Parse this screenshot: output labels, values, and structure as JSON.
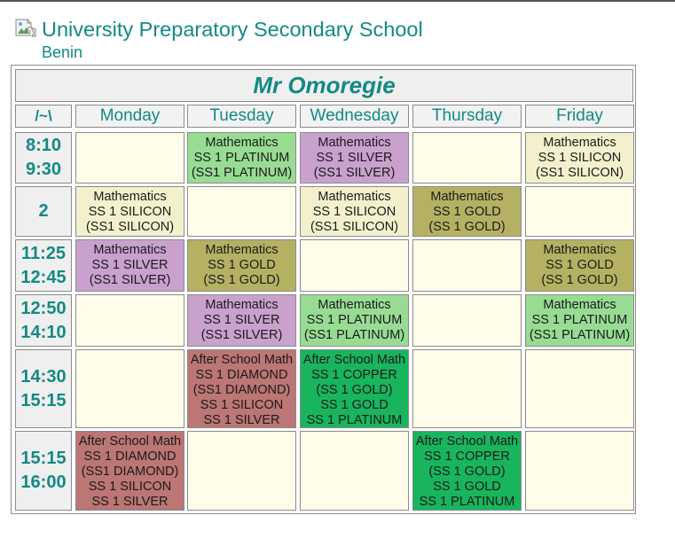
{
  "school": {
    "name": "University Preparatory Secondary School",
    "location": "Benin"
  },
  "timetable": {
    "teacher": "Mr Omoregie",
    "corner_label": "/~\\",
    "days": [
      "Monday",
      "Tuesday",
      "Wednesday",
      "Thursday",
      "Friday"
    ],
    "periods": [
      {
        "time": [
          "8:10",
          "9:30"
        ],
        "slots": [
          null,
          {
            "lines": [
              "Mathematics",
              "SS 1 PLATINUM",
              "(SS1 PLATINUM)"
            ],
            "color": "#98dc94"
          },
          {
            "lines": [
              "Mathematics",
              "SS 1 SILVER",
              "(SS1 SILVER)"
            ],
            "color": "#c8a2cd"
          },
          null,
          {
            "lines": [
              "Mathematics",
              "SS 1 SILICON",
              "(SS1 SILICON)"
            ],
            "color": "#f3f1cd"
          }
        ]
      },
      {
        "time": [
          "2"
        ],
        "slots": [
          {
            "lines": [
              "Mathematics",
              "SS 1 SILICON",
              "(SS1 SILICON)"
            ],
            "color": "#f3f1cd"
          },
          null,
          {
            "lines": [
              "Mathematics",
              "SS 1 SILICON",
              "(SS1 SILICON)"
            ],
            "color": "#f3f1cd"
          },
          {
            "lines": [
              "Mathematics",
              "SS 1 GOLD",
              "(SS 1 GOLD)"
            ],
            "color": "#b5b163"
          },
          null
        ]
      },
      {
        "time": [
          "11:25",
          "12:45"
        ],
        "slots": [
          {
            "lines": [
              "Mathematics",
              "SS 1 SILVER",
              "(SS1 SILVER)"
            ],
            "color": "#c8a2cd"
          },
          {
            "lines": [
              "Mathematics",
              "SS 1 GOLD",
              "(SS 1 GOLD)"
            ],
            "color": "#b5b163"
          },
          null,
          null,
          {
            "lines": [
              "Mathematics",
              "SS 1 GOLD",
              "(SS 1 GOLD)"
            ],
            "color": "#b5b163"
          }
        ]
      },
      {
        "time": [
          "12:50",
          "14:10"
        ],
        "slots": [
          null,
          {
            "lines": [
              "Mathematics",
              "SS 1 SILVER",
              "(SS1 SILVER)"
            ],
            "color": "#c8a2cd"
          },
          {
            "lines": [
              "Mathematics",
              "SS 1 PLATINUM",
              "(SS1 PLATINUM)"
            ],
            "color": "#98dc94"
          },
          null,
          {
            "lines": [
              "Mathematics",
              "SS 1 PLATINUM",
              "(SS1 PLATINUM)"
            ],
            "color": "#98dc94"
          }
        ]
      },
      {
        "time": [
          "14:30",
          "15:15"
        ],
        "slots": [
          null,
          {
            "lines": [
              "After School Math",
              "SS 1 DIAMOND",
              "(SS1 DIAMOND)",
              "SS 1 SILICON",
              "SS 1 SILVER"
            ],
            "color": "#bc7674"
          },
          {
            "lines": [
              "After School Math",
              "SS 1 COPPER",
              "(SS 1 GOLD)",
              "SS 1 GOLD",
              "SS 1 PLATINUM"
            ],
            "color": "#18b55e"
          },
          null,
          null
        ]
      },
      {
        "time": [
          "15:15",
          "16:00"
        ],
        "slots": [
          {
            "lines": [
              "After School Math",
              "SS 1 DIAMOND",
              "(SS1 DIAMOND)",
              "SS 1 SILICON",
              "SS 1 SILVER"
            ],
            "color": "#bc7674"
          },
          null,
          null,
          {
            "lines": [
              "After School Math",
              "SS 1 COPPER",
              "(SS 1 GOLD)",
              "SS 1 GOLD",
              "SS 1 PLATINUM"
            ],
            "color": "#18b55e"
          },
          null
        ]
      }
    ]
  }
}
